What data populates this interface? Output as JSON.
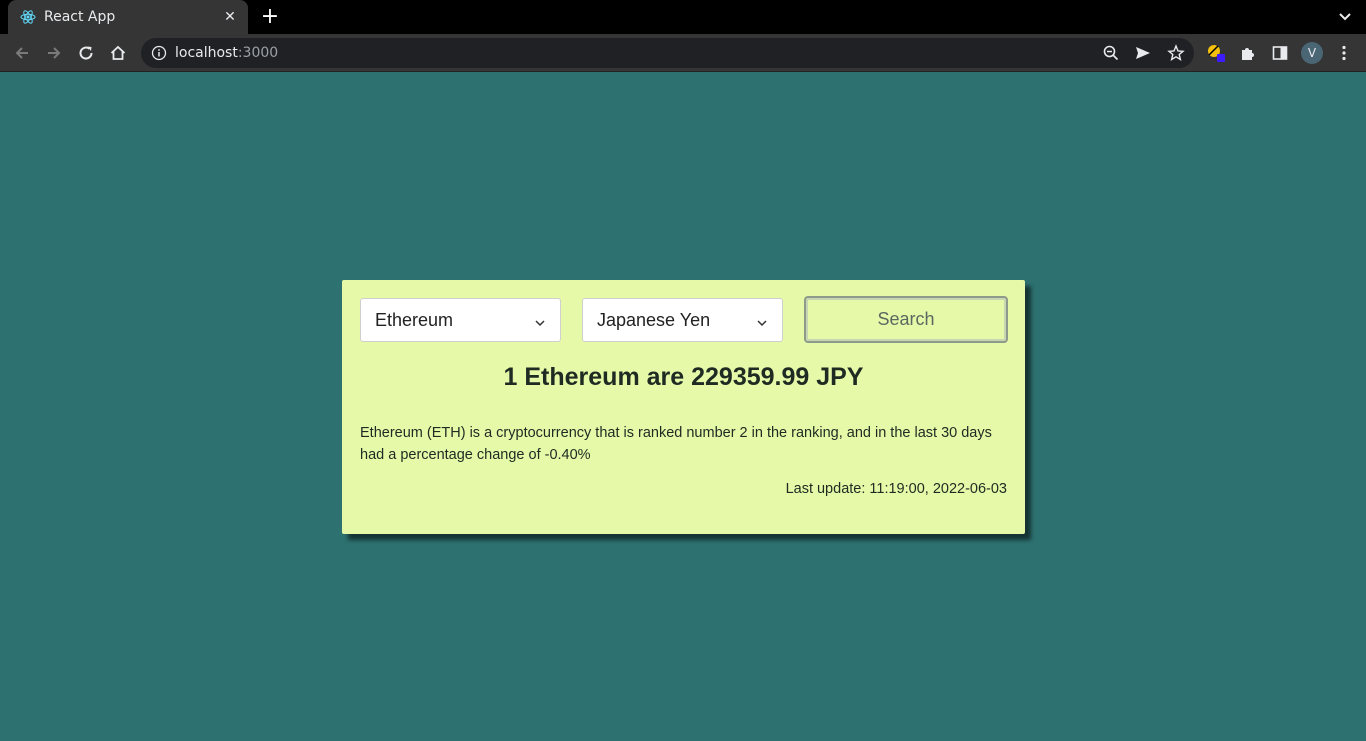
{
  "browser": {
    "tab_title": "React App",
    "close_glyph": "✕",
    "new_tab_glyph": "+",
    "url_host": "localhost",
    "url_port": ":3000",
    "profile_initial": "V"
  },
  "icons": {
    "tab_favicon": "react-logo-icon",
    "back": "arrow-left-icon",
    "forward": "arrow-right-icon",
    "reload": "reload-icon",
    "home": "home-icon",
    "site_info": "info-icon",
    "zoom": "zoom-out-icon",
    "send": "send-icon",
    "bookmark": "star-icon",
    "extension_color": "color-picker-icon",
    "extensions": "puzzle-icon",
    "side_panel": "side-panel-icon",
    "menu": "kebab-menu-icon"
  },
  "colors": {
    "page_background": "#2d7170",
    "card_background": "#e6f9a8",
    "text": "#1e2a22"
  },
  "converter": {
    "crypto_select": {
      "value": "Ethereum"
    },
    "currency_select": {
      "value": "Japanese Yen"
    },
    "search_label": "Search",
    "result": "1 Ethereum are 229359.99 JPY",
    "description": "Ethereum (ETH) is a cryptocurrency that is ranked number 2 in the ranking, and in the last 30 days had a percentage change of -0.40%",
    "last_update": "Last update: 11:19:00, 2022-06-03"
  }
}
